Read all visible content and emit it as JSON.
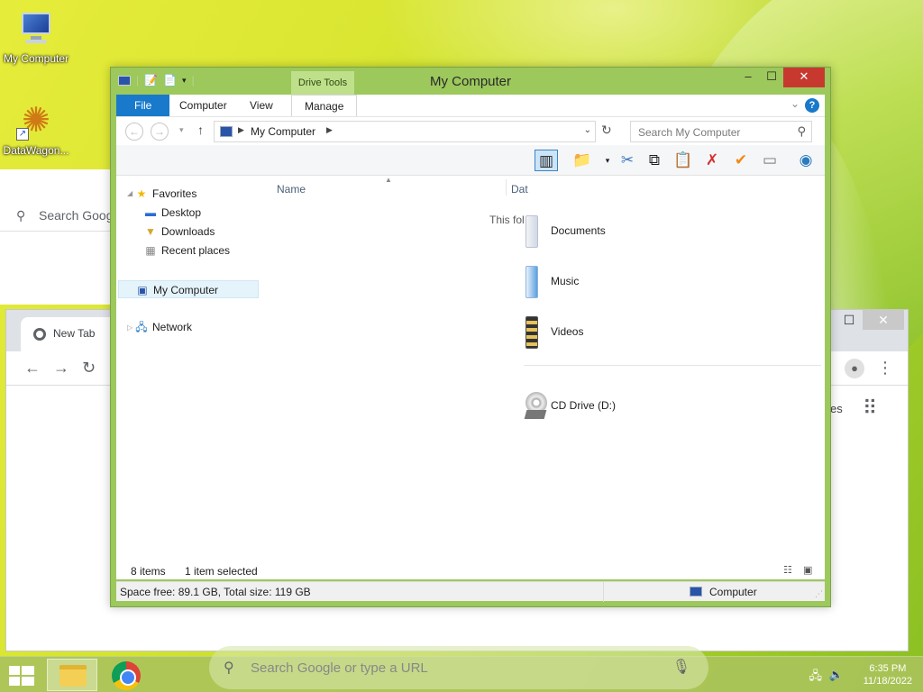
{
  "desktop": {
    "icons": [
      {
        "label": "My Computer"
      },
      {
        "label": "DataWagon..."
      }
    ]
  },
  "chrome_window": {
    "tab_label": "New Tab",
    "search_placeholder": "Search Goog",
    "apps_partial_text": "es"
  },
  "explorer": {
    "title": "My Computer",
    "contextual_tab": "Drive Tools",
    "ribbon_tabs": [
      "File",
      "Computer",
      "View",
      "Manage"
    ],
    "address": {
      "root": "My Computer"
    },
    "search_placeholder": "Search My Computer",
    "nav": {
      "favorites": "Favorites",
      "desktop": "Desktop",
      "downloads": "Downloads",
      "recent_places": "Recent places",
      "my_computer": "My Computer",
      "network": "Network"
    },
    "columns": {
      "name": "Name",
      "date": "Dat"
    },
    "this_folder_partial": "This fol",
    "items": [
      {
        "name": "Documents"
      },
      {
        "name": "Music"
      },
      {
        "name": "Videos"
      },
      {
        "name": "CD Drive (D:)"
      }
    ],
    "status": {
      "count": "8 items",
      "selection": "1 item selected",
      "space": "Space free: 89.1 GB, Total size: 119 GB",
      "location": "Computer"
    }
  },
  "taskbar": {
    "search_placeholder": "Search Google or type a URL",
    "time": "6:35 PM",
    "date": "11/18/2022"
  }
}
